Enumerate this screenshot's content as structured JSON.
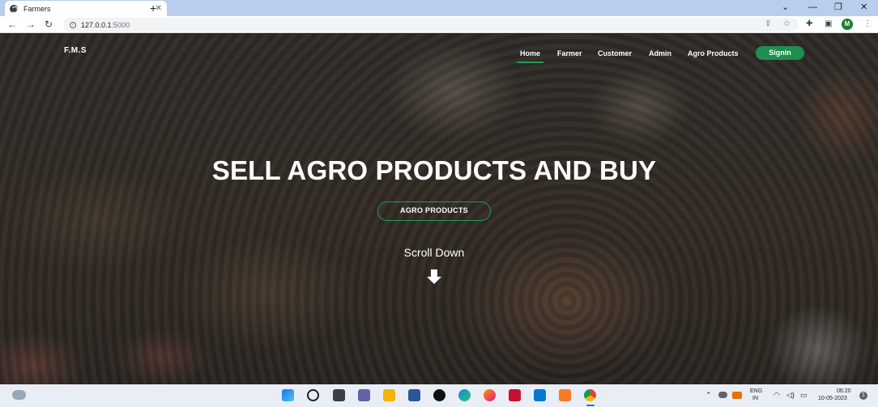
{
  "browser": {
    "tab_title": "Farmers",
    "tab_close": "✕",
    "new_tab": "+",
    "url_host": "127.0.0.1",
    "url_port": ":5000",
    "profile_initial": "M",
    "window_controls": [
      "⌄",
      "—",
      "❐",
      "✕"
    ]
  },
  "navbar": {
    "brand": "F.M.S",
    "items": [
      {
        "label": "Home",
        "active": true
      },
      {
        "label": "Farmer",
        "active": false
      },
      {
        "label": "Customer",
        "active": false
      },
      {
        "label": "Admin",
        "active": false
      },
      {
        "label": "Agro Products",
        "active": false
      }
    ],
    "signin_label": "Signin"
  },
  "hero": {
    "title": "SELL AGRO PRODUCTS AND BUY",
    "button_label": "AGRO PRODUCTS",
    "scroll_label": "Scroll Down"
  },
  "taskbar": {
    "language": "ENG",
    "region": "IN",
    "time": "06:20",
    "date": "10-05-2023",
    "notification_count": "1"
  },
  "colors": {
    "accent_green": "#1e8f4e",
    "tabstrip": "#b9cdec",
    "taskbar": "#e9eef6"
  }
}
